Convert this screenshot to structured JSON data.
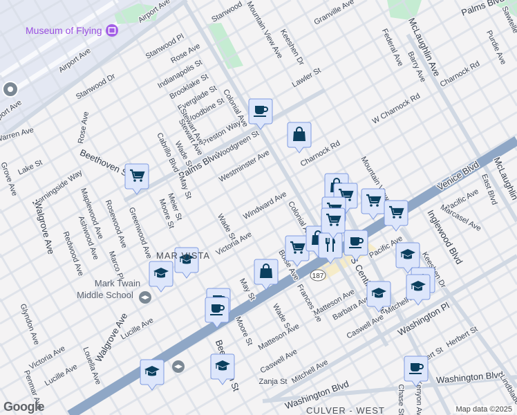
{
  "map": {
    "labels": [
      "Airport Ave",
      "Airport Ave",
      "Stanwood Dr",
      "Stanwood Pl",
      "Rose Ave",
      "Indianapolis St",
      "Brooklake St",
      "Everglade St",
      "Woodbine St",
      "Colonial Ave",
      "Stewart Ave",
      "Wade St",
      "Cabrillo Blvd",
      "Preston Way",
      "Palms Blvd",
      "Woodgreen St",
      "Westminster Ave",
      "Rose Ave",
      "Warren Ave",
      "Beethoven St",
      "Lake St",
      "Morningside Way",
      "Grove Ave",
      "Mountain View Ave",
      "Keeshen Dr",
      "Lawler St",
      "Granville Ave",
      "Stanwood",
      "Palms Blvd",
      "McLaughlin Ave",
      "Federal Ave",
      "Barry Ave",
      "Purdie Ave",
      "Charnock Rd",
      "W Charnock Rd",
      "Charnock Rd",
      "Mountain View",
      "Venice Blvd",
      "McLaughlin",
      "East Blvd",
      "Pacific Ave",
      "Marcasel Ave",
      "Inglewood Blvd",
      "Keeshen Dr",
      "Pacific Ave",
      "Windward Ave",
      "Wade St",
      "Victoria Ave",
      "Colonial Ave",
      "May St",
      "Meier St",
      "Moore St",
      "Greenwood Ave",
      "Rosewood Ave",
      "Maplewood Ave",
      "Ashwood Ave",
      "Redwood Ave",
      "Marco Pl",
      "Walgrove Ave",
      "Walgrove Ave",
      "Lucille Ave",
      "Glyndon Ave",
      "Victoria Ave",
      "Louella Ave",
      "Lucille Ave",
      "Penmar Ave",
      "May St",
      "Moore St",
      "Beethoven St",
      "Boise Ave",
      "Wade St",
      "Frances Ave",
      "Matteson Ave",
      "Barbara Ave",
      "Caswell Ave",
      "S Centinela Ave",
      "Mitchell Ave",
      "Washington Pl",
      "Herbert St",
      "Matteson Ave",
      "Caswell Ave",
      "Mitchell Ave",
      "Zanja St",
      "Washington Blvd",
      "Washington Blvd",
      "Chase St",
      "Kenyon Ave",
      "Herbert St",
      "Sawtelle",
      "Stewart Ave",
      "Airport Ave",
      "Lindblade"
    ],
    "poi": {
      "museum": "Museum of Flying",
      "school_line1": "Mark Twain",
      "school_line2": "Middle School"
    },
    "areas": {
      "mar_vista": "MAR VISTA",
      "culver_west": "CULVER - WEST"
    },
    "route_shield": "187",
    "markers": [
      "cart",
      "coffee",
      "bag",
      "bag",
      "cart",
      "cart",
      "cart",
      "cart",
      "cart",
      "bag",
      "restaurant",
      "coffee",
      "cart",
      "school",
      "school",
      "coffee",
      "coffee",
      "bag",
      "school",
      "school",
      "school",
      "school",
      "school",
      "school",
      "coffee"
    ],
    "credit": "Map data ©2025",
    "logo": "Google"
  },
  "colors": {
    "marker_bg": "#dde6fb",
    "marker_border": "#7f9be0",
    "icon": "#0b3f5e",
    "highway": "#8fa7c6",
    "road": "#d8dee7",
    "park": "#c5ecd2",
    "airport": "#e4e8f3"
  }
}
